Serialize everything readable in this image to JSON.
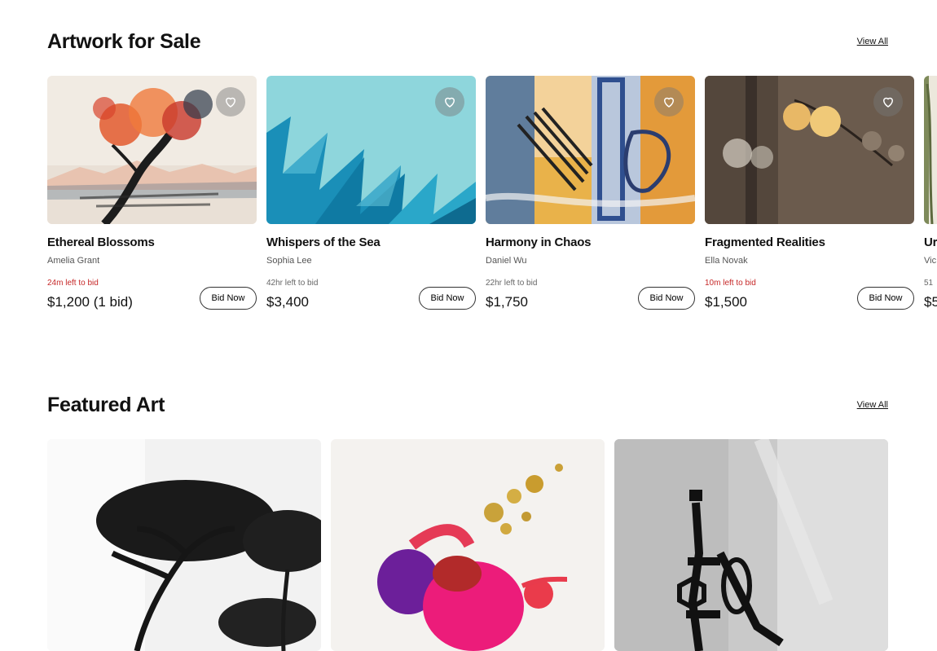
{
  "sale_section": {
    "title": "Artwork for Sale",
    "view_all": "View All",
    "cards": [
      {
        "title": "Ethereal Blossoms",
        "artist": "Amelia Grant",
        "time_left": "24m left to bid",
        "urgent": true,
        "price": "$1,200 (1 bid)",
        "button": "Bid Now"
      },
      {
        "title": "Whispers of the Sea",
        "artist": "Sophia Lee",
        "time_left": "42hr left to bid",
        "urgent": false,
        "price": "$3,400",
        "button": "Bid Now"
      },
      {
        "title": "Harmony in Chaos",
        "artist": "Daniel Wu",
        "time_left": "22hr left to bid",
        "urgent": false,
        "price": "$1,750",
        "button": "Bid Now"
      },
      {
        "title": "Fragmented Realities",
        "artist": "Ella Novak",
        "time_left": "10m left to bid",
        "urgent": true,
        "price": "$1,500",
        "button": "Bid Now"
      },
      {
        "title": "Ur",
        "artist": "Vic",
        "time_left": "51",
        "urgent": false,
        "price": "$5",
        "button": ""
      }
    ]
  },
  "featured_section": {
    "title": "Featured Art",
    "view_all": "View All"
  },
  "colors": {
    "urgent_text": "#c62828",
    "heart_bg": "#787878"
  },
  "icons": {
    "favorite": "heart-icon"
  }
}
